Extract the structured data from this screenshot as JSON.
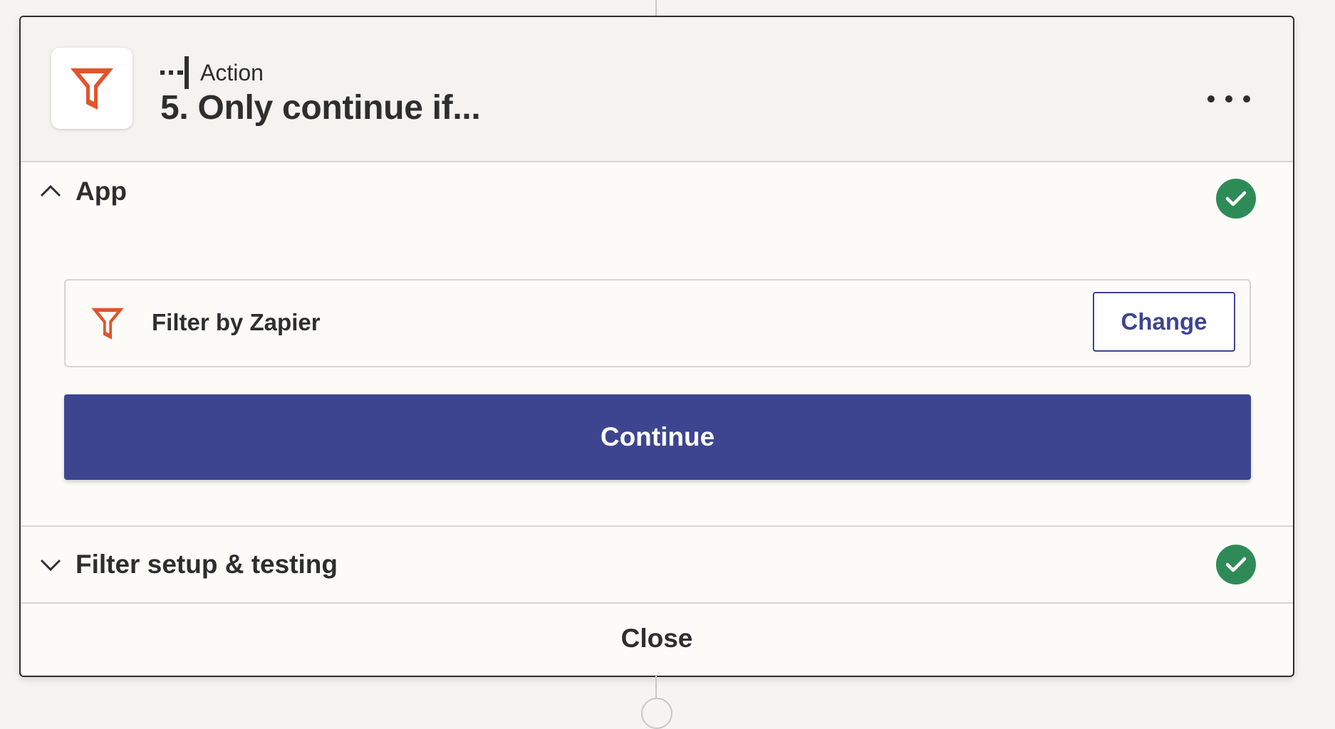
{
  "header": {
    "step_kind": "Action",
    "step_title": "5. Only continue if..."
  },
  "app_section": {
    "title": "App",
    "status": "complete",
    "selected_app": "Filter by Zapier",
    "change_label": "Change",
    "continue_label": "Continue"
  },
  "filter_section": {
    "title": "Filter setup & testing",
    "status": "complete"
  },
  "footer": {
    "close_label": "Close"
  },
  "colors": {
    "brand_orange": "#e2542c",
    "primary_button": "#3d4590",
    "success_green": "#2e8b57"
  },
  "icons": {
    "app_logo": "filter-funnel-icon",
    "step_kind": "action-step-icon",
    "more": "more-horizontal-icon",
    "expanded": "chevron-up-icon",
    "collapsed": "chevron-down-icon",
    "status": "check-circle-icon"
  }
}
